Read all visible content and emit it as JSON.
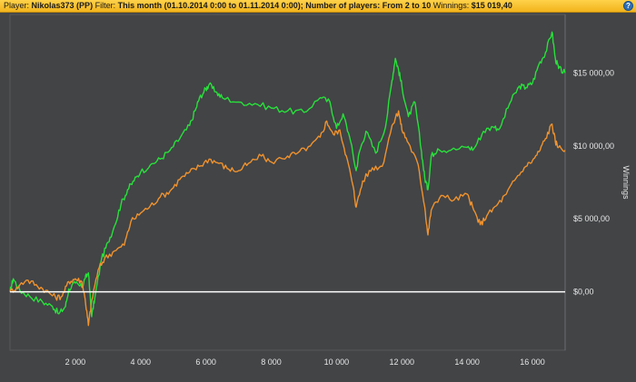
{
  "header": {
    "player_label": "Player:",
    "player_value": "Nikolas373 (PP)",
    "filter_label": "Filter:",
    "filter_value": "This month (01.10.2014 0:00 to 01.11.2014 0:00); Number of players: From 2 to 10",
    "winnings_label": "Winnings:",
    "winnings_value": "$15 019,40",
    "help_icon": "?"
  },
  "colors": {
    "background": "#424446",
    "header": "#f6bd27",
    "winnings_line": "#28e03a",
    "showdown_line": "#f0922e",
    "zero_line": "#ffffff",
    "grid": "#55585b"
  },
  "chart_data": {
    "type": "line",
    "xlabel": "",
    "ylabel": "Winnings",
    "xlim": [
      0,
      17000
    ],
    "ylim": [
      -4000,
      19000
    ],
    "x_ticks": [
      2000,
      4000,
      6000,
      8000,
      10000,
      12000,
      14000,
      16000
    ],
    "x_tick_labels": [
      "2 000",
      "4 000",
      "6 000",
      "8 000",
      "10 000",
      "12 000",
      "14 000",
      "16 000"
    ],
    "y_ticks": [
      0,
      5000,
      10000,
      15000
    ],
    "y_tick_labels": [
      "$0,00",
      "$5 000,00",
      "$10 000,00",
      "$15 000,00"
    ],
    "grid": false,
    "legend": "none",
    "series": [
      {
        "color": "#28e03a",
        "points": [
          [
            0,
            0
          ],
          [
            100,
            900
          ],
          [
            300,
            100
          ],
          [
            600,
            -300
          ],
          [
            1000,
            -700
          ],
          [
            1300,
            -1000
          ],
          [
            1500,
            -1500
          ],
          [
            1700,
            -1000
          ],
          [
            1800,
            200
          ],
          [
            2000,
            600
          ],
          [
            2200,
            300
          ],
          [
            2300,
            900
          ],
          [
            2400,
            1300
          ],
          [
            2500,
            -1700
          ],
          [
            2600,
            -400
          ],
          [
            2800,
            2200
          ],
          [
            3000,
            3400
          ],
          [
            3200,
            4500
          ],
          [
            3400,
            6000
          ],
          [
            3600,
            7000
          ],
          [
            3800,
            7600
          ],
          [
            4000,
            8200
          ],
          [
            4300,
            8700
          ],
          [
            4600,
            9100
          ],
          [
            4900,
            9700
          ],
          [
            5200,
            10500
          ],
          [
            5500,
            11400
          ],
          [
            5700,
            12600
          ],
          [
            5800,
            13300
          ],
          [
            6000,
            13900
          ],
          [
            6100,
            14200
          ],
          [
            6300,
            13700
          ],
          [
            6500,
            13300
          ],
          [
            7000,
            13000
          ],
          [
            7500,
            12900
          ],
          [
            8000,
            12600
          ],
          [
            8500,
            12400
          ],
          [
            9000,
            12300
          ],
          [
            9500,
            13300
          ],
          [
            9800,
            13000
          ],
          [
            10000,
            11200
          ],
          [
            10200,
            12200
          ],
          [
            10400,
            10600
          ],
          [
            10600,
            8300
          ],
          [
            10700,
            9600
          ],
          [
            10900,
            11000
          ],
          [
            11200,
            9500
          ],
          [
            11500,
            11300
          ],
          [
            11700,
            14500
          ],
          [
            11800,
            16000
          ],
          [
            11900,
            15200
          ],
          [
            12000,
            14100
          ],
          [
            12200,
            12000
          ],
          [
            12400,
            13000
          ],
          [
            12600,
            9600
          ],
          [
            12700,
            7800
          ],
          [
            12800,
            7000
          ],
          [
            12900,
            9300
          ],
          [
            13100,
            9800
          ],
          [
            13500,
            9700
          ],
          [
            14000,
            9900
          ],
          [
            14200,
            9800
          ],
          [
            14500,
            11000
          ],
          [
            14800,
            11300
          ],
          [
            15000,
            11200
          ],
          [
            15300,
            12900
          ],
          [
            15600,
            14100
          ],
          [
            15800,
            14000
          ],
          [
            16000,
            14300
          ],
          [
            16200,
            15600
          ],
          [
            16400,
            16400
          ],
          [
            16600,
            17800
          ],
          [
            16700,
            16000
          ],
          [
            16800,
            15300
          ],
          [
            17000,
            15000
          ]
        ]
      },
      {
        "color": "#f0922e",
        "points": [
          [
            0,
            0
          ],
          [
            200,
            300
          ],
          [
            500,
            800
          ],
          [
            800,
            500
          ],
          [
            1100,
            100
          ],
          [
            1400,
            -400
          ],
          [
            1600,
            -300
          ],
          [
            1800,
            700
          ],
          [
            2000,
            900
          ],
          [
            2200,
            700
          ],
          [
            2300,
            -500
          ],
          [
            2400,
            -2300
          ],
          [
            2500,
            -600
          ],
          [
            2700,
            1500
          ],
          [
            2900,
            2300
          ],
          [
            3200,
            2800
          ],
          [
            3500,
            3200
          ],
          [
            3700,
            4800
          ],
          [
            4000,
            5400
          ],
          [
            4300,
            5900
          ],
          [
            4600,
            6500
          ],
          [
            4900,
            6900
          ],
          [
            5200,
            7700
          ],
          [
            5500,
            8200
          ],
          [
            5800,
            8600
          ],
          [
            6100,
            9100
          ],
          [
            6400,
            8800
          ],
          [
            6700,
            8400
          ],
          [
            7000,
            8300
          ],
          [
            7300,
            8800
          ],
          [
            7700,
            9300
          ],
          [
            8000,
            8900
          ],
          [
            8500,
            9300
          ],
          [
            8800,
            9500
          ],
          [
            9200,
            10000
          ],
          [
            9500,
            10600
          ],
          [
            9700,
            11700
          ],
          [
            9900,
            10800
          ],
          [
            10100,
            11100
          ],
          [
            10300,
            9300
          ],
          [
            10500,
            7300
          ],
          [
            10600,
            5800
          ],
          [
            10800,
            7600
          ],
          [
            11100,
            8500
          ],
          [
            11400,
            8600
          ],
          [
            11700,
            11400
          ],
          [
            11900,
            12400
          ],
          [
            12000,
            11100
          ],
          [
            12200,
            10200
          ],
          [
            12500,
            8700
          ],
          [
            12700,
            5800
          ],
          [
            12800,
            3900
          ],
          [
            12900,
            5600
          ],
          [
            13200,
            6600
          ],
          [
            13600,
            6300
          ],
          [
            14000,
            6700
          ],
          [
            14200,
            5600
          ],
          [
            14400,
            4600
          ],
          [
            14600,
            5200
          ],
          [
            14900,
            5900
          ],
          [
            15200,
            6700
          ],
          [
            15500,
            7800
          ],
          [
            15800,
            8600
          ],
          [
            16000,
            9000
          ],
          [
            16200,
            9600
          ],
          [
            16400,
            10500
          ],
          [
            16600,
            11500
          ],
          [
            16700,
            10300
          ],
          [
            16800,
            9900
          ],
          [
            17000,
            9700
          ]
        ]
      }
    ]
  }
}
